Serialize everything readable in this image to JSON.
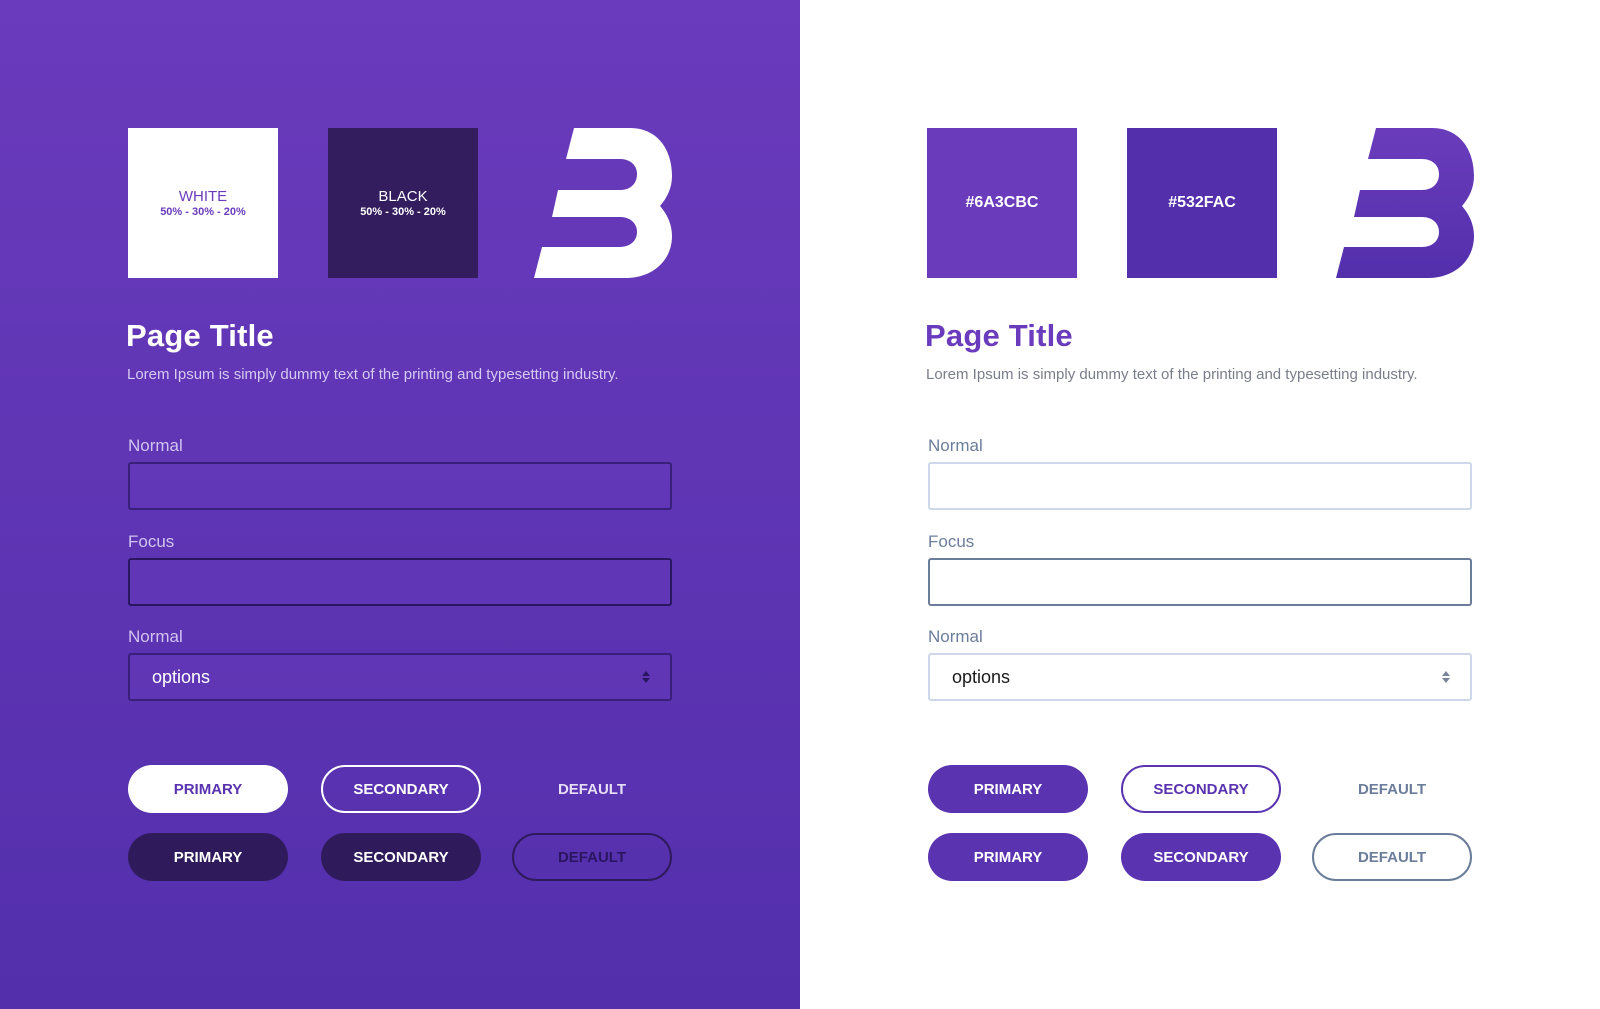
{
  "colors": {
    "purple": "#6A3CBC",
    "deep_purple": "#532FAC",
    "black_swatch": "#331d5e",
    "dark_button": "#2f1b5c",
    "muted_label_dark": "#c9b8ec",
    "light_label": "#6b7d9a",
    "light_border": "#cdd8ea",
    "focus_border": "#6b7d9a"
  },
  "dark": {
    "swatch_white": {
      "name": "WHITE",
      "percent": "50% - 30% - 20%"
    },
    "swatch_black": {
      "name": "BLACK",
      "percent": "50% - 30% - 20%"
    },
    "logo_icon": "b-logo-icon",
    "page_title": "Page Title",
    "page_description": "Lorem Ipsum is simply dummy text of the printing and typesetting industry.",
    "form": {
      "normal_label": "Normal",
      "focus_label": "Focus",
      "select_label": "Normal",
      "select_value": "options"
    },
    "buttons": {
      "row1": [
        "PRIMARY",
        "SECONDARY",
        "DEFAULT"
      ],
      "row2": [
        "PRIMARY",
        "SECONDARY",
        "DEFAULT"
      ]
    }
  },
  "light": {
    "swatch_1": {
      "hex": "#6A3CBC"
    },
    "swatch_2": {
      "hex": "#532FAC"
    },
    "logo_icon": "b-logo-icon",
    "page_title": "Page Title",
    "page_description": "Lorem Ipsum is simply dummy text of the printing and typesetting industry.",
    "form": {
      "normal_label": "Normal",
      "focus_label": "Focus",
      "select_label": "Normal",
      "select_value": "options"
    },
    "buttons": {
      "row1": [
        "PRIMARY",
        "SECONDARY",
        "DEFAULT"
      ],
      "row2": [
        "PRIMARY",
        "SECONDARY",
        "DEFAULT"
      ]
    }
  }
}
